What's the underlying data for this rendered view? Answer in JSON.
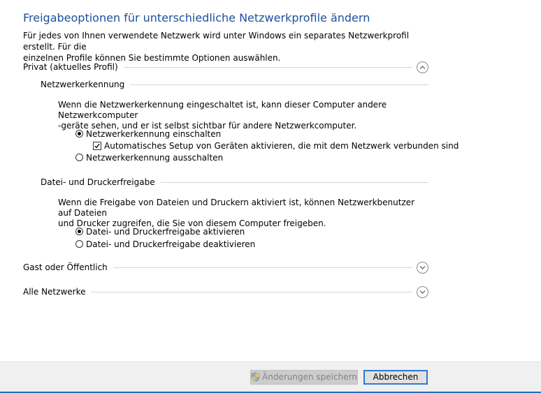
{
  "page": {
    "title": "Freigabeoptionen für unterschiedliche Netzwerkprofile ändern",
    "intro_line1": "Für jedes von Ihnen verwendete Netzwerk wird unter Windows ein separates Netzwerkprofil erstellt. Für die",
    "intro_line2": "einzelnen Profile können Sie bestimmte Optionen auswählen."
  },
  "private": {
    "label": "Privat (aktuelles Profil)",
    "expanded": true,
    "discovery": {
      "heading": "Netzwerkerkennung",
      "desc_line1": "Wenn die Netzwerkerkennung eingeschaltet ist, kann dieser Computer andere Netzwerkcomputer",
      "desc_line2": "-geräte sehen, und er ist selbst sichtbar für andere Netzwerkcomputer.",
      "option_on": "Netzwerkerkennung einschalten",
      "auto_setup": "Automatisches Setup von Geräten aktivieren, die mit dem Netzwerk verbunden sind",
      "option_off": "Netzwerkerkennung ausschalten"
    },
    "sharing": {
      "heading": "Datei- und Druckerfreigabe",
      "desc_line1": "Wenn die Freigabe von Dateien und Druckern aktiviert ist, können Netzwerkbenutzer auf Dateien",
      "desc_line2": "und Drucker zugreifen, die Sie von diesem Computer freigeben.",
      "option_on": "Datei- und Druckerfreigabe aktivieren",
      "option_off": "Datei- und Druckerfreigabe deaktivieren"
    }
  },
  "guest": {
    "label": "Gast oder Öffentlich",
    "expanded": false
  },
  "all": {
    "label": "Alle Netzwerke",
    "expanded": false
  },
  "footer": {
    "save_label": "Änderungen speichern",
    "cancel_label": "Abbrechen"
  },
  "colors": {
    "title": "#1f4e9c",
    "accent": "#2b78d4",
    "footer_bg": "#f0f0f0",
    "bottom_line": "#1e70c1"
  },
  "icons": {
    "expanded": "chevron-up-icon",
    "collapsed": "chevron-down-icon",
    "uac": "uac-shield-icon"
  }
}
